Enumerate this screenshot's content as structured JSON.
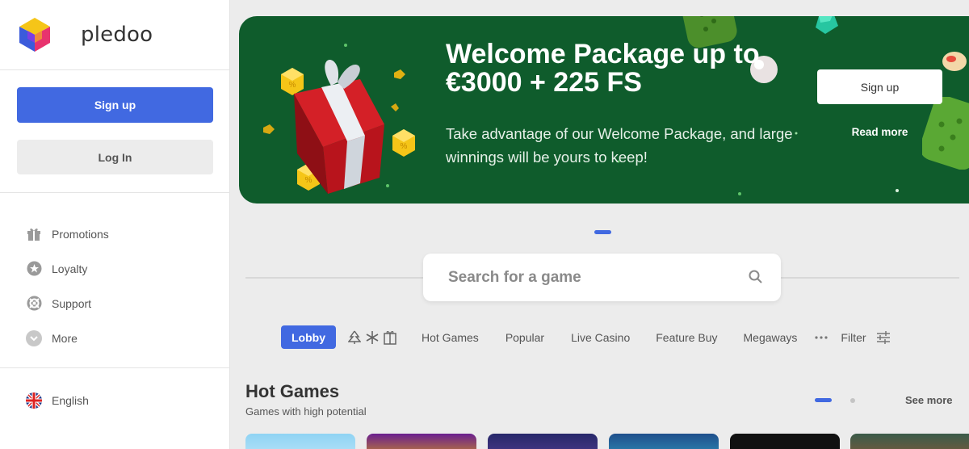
{
  "brand": {
    "name": "pledoo"
  },
  "sidebar": {
    "signup_label": "Sign up",
    "login_label": "Log In",
    "items": [
      {
        "label": "Promotions",
        "icon": "gift-icon"
      },
      {
        "label": "Loyalty",
        "icon": "star-icon"
      },
      {
        "label": "Support",
        "icon": "lifebuoy-icon"
      },
      {
        "label": "More",
        "icon": "chevron-down-icon"
      }
    ],
    "language": {
      "label": "English",
      "icon": "uk-flag-icon"
    }
  },
  "banner": {
    "title": "Welcome Package up to €3000 + 225 FS",
    "subtitle": "Take advantage of our Welcome Package, and large winnings will be yours to keep!",
    "cta_label": "Sign up",
    "more_label": "Read more",
    "bg_color": "#0f5c2c"
  },
  "search": {
    "placeholder": "Search for a game"
  },
  "categories": {
    "active": "Lobby",
    "items": [
      "Hot Games",
      "Popular",
      "Live Casino",
      "Feature Buy",
      "Megaways"
    ],
    "filter_label": "Filter"
  },
  "section": {
    "title": "Hot Games",
    "subtitle": "Games with high potential",
    "see_more_label": "See more"
  },
  "colors": {
    "accent": "#4169e1"
  }
}
